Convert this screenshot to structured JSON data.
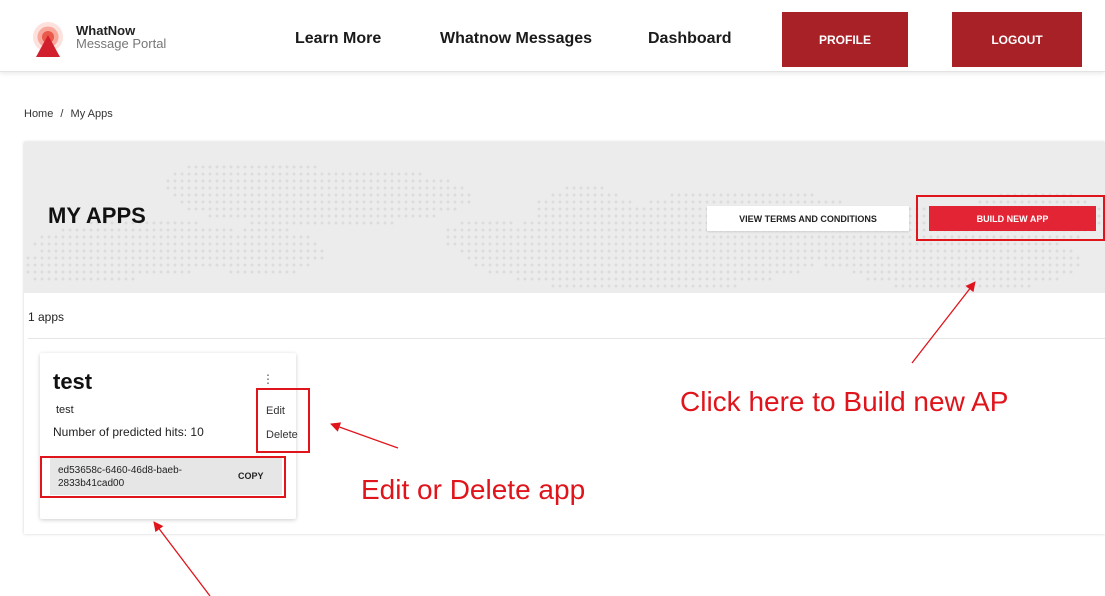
{
  "nav": {
    "brand_line1": "WhatNow",
    "brand_line2": "Message Portal",
    "links": [
      "Learn More",
      "Whatnow Messages",
      "Dashboard"
    ],
    "profile_label": "PROFILE",
    "logout_label": "LOGOUT",
    "accent": "#a82127"
  },
  "breadcrumb": {
    "home": "Home",
    "separator": "/",
    "current": "My Apps"
  },
  "hero": {
    "title": "MY APPS",
    "terms_label": "VIEW TERMS AND CONDITIONS",
    "build_label": "BUILD NEW APP",
    "build_color": "#e32434"
  },
  "apps_count": "1 apps",
  "app": {
    "name": "test",
    "description": "test",
    "hits": "Number of predicted hits: 10",
    "menu": {
      "edit": "Edit",
      "delete": "Delete"
    },
    "key_line1": "ed53658c-6460-46d8-baeb-",
    "key_line2": "2833b41cad00",
    "copy_label": "COPY"
  },
  "annotations": {
    "build": "Click here to Build new AP",
    "edit_delete": "Edit or Delete app",
    "color": "#e0141b"
  }
}
